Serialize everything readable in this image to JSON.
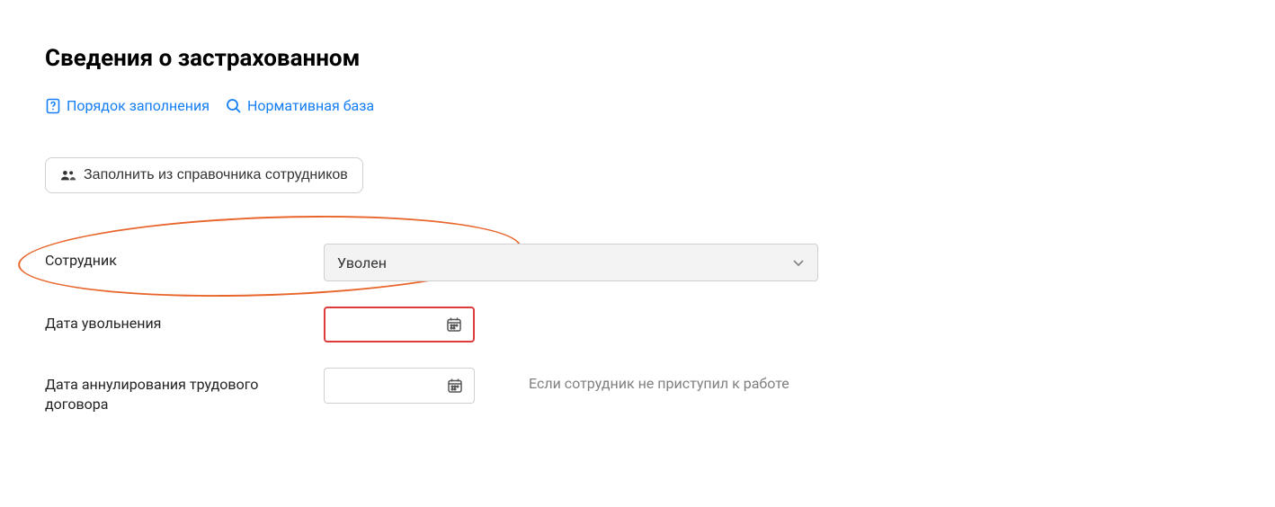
{
  "page": {
    "title": "Сведения о застрахованном"
  },
  "links": {
    "fill_order": "Порядок заполнения",
    "normative": "Нормативная база"
  },
  "buttons": {
    "fill_from_directory": "Заполнить из справочника сотрудников"
  },
  "form": {
    "employee": {
      "label": "Сотрудник",
      "value": "Уволен"
    },
    "dismissal_date": {
      "label": "Дата увольнения",
      "value": ""
    },
    "cancellation_date": {
      "label": "Дата аннулирования трудового договора",
      "value": "",
      "hint": "Если сотрудник не приступил к работе"
    }
  }
}
